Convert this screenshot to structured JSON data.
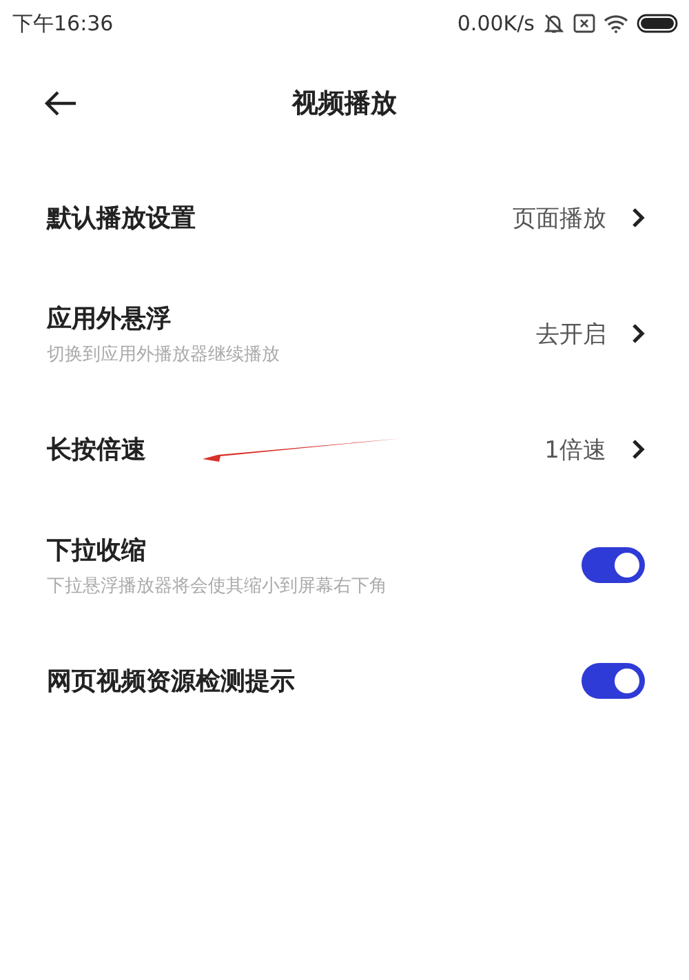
{
  "status_bar": {
    "time": "下午16:36",
    "network_speed": "0.00K/s"
  },
  "header": {
    "title": "视频播放"
  },
  "settings": [
    {
      "kind": "link",
      "title": "默认播放设置",
      "value": "页面播放"
    },
    {
      "kind": "link",
      "title": "应用外悬浮",
      "subtitle": "切换到应用外播放器继续播放",
      "value": "去开启"
    },
    {
      "kind": "link",
      "title": "长按倍速",
      "value": "1倍速"
    },
    {
      "kind": "switch",
      "title": "下拉收缩",
      "subtitle": "下拉悬浮播放器将会使其缩小到屏幕右下角",
      "on": true
    },
    {
      "kind": "switch",
      "title": "网页视频资源检测提示",
      "on": true
    }
  ]
}
